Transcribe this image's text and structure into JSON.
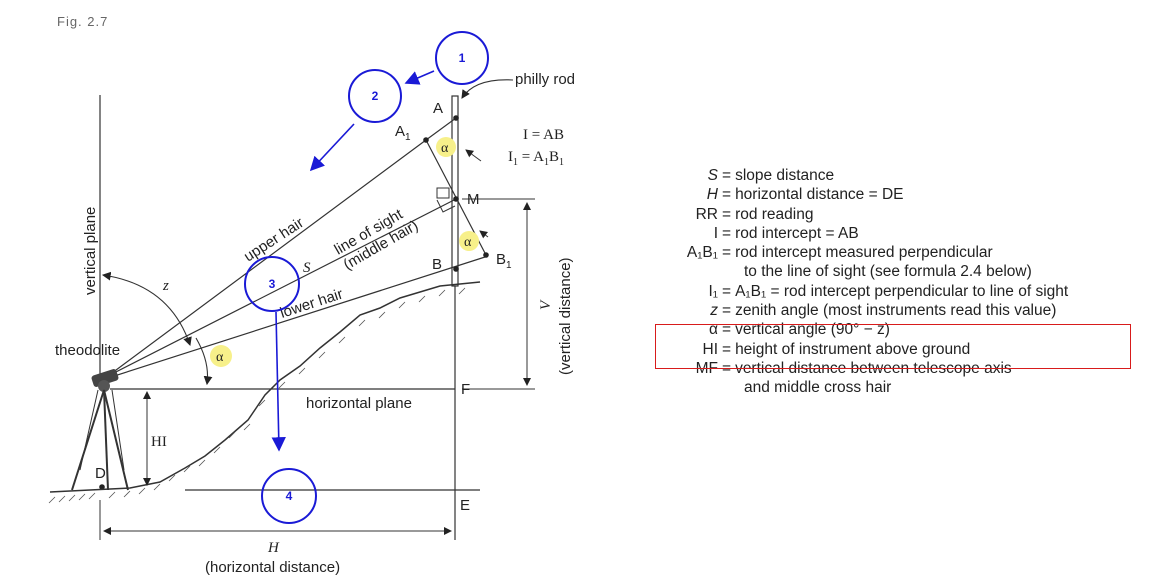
{
  "figure_header": "Fig. 2.7",
  "diagram": {
    "labels": {
      "philly_rod": "philly rod",
      "vertical_plane": "vertical plane",
      "upper_hair": "upper hair",
      "line_of_sight": "line of sight",
      "middle_hair": "(middle hair)",
      "lower_hair": "lower hair",
      "S": "S",
      "z": "z",
      "theodolite": "theodolite",
      "horizontal_plane": "horizontal plane",
      "HI": "HI",
      "D": "D",
      "A": "A",
      "A1": "A",
      "A1_sub": "1",
      "M": "M",
      "B": "B",
      "B1": "B",
      "B1_sub": "1",
      "F": "F",
      "E": "E",
      "V": "V",
      "vertical_distance": "(vertical distance)",
      "H": "H",
      "horizontal_distance": "(horizontal distance)",
      "I_eq": "I = AB",
      "I1_eq_a": "I",
      "I1_eq_sub": "1",
      "I1_eq_b": " = A",
      "I1_eq_c": "B",
      "alpha": "α"
    },
    "markers": [
      {
        "id": "1",
        "label": "1"
      },
      {
        "id": "2",
        "label": "2"
      },
      {
        "id": "3",
        "label": "3"
      },
      {
        "id": "4",
        "label": "4"
      }
    ],
    "colors": {
      "marker": "#1a1ad6",
      "highlight_dot": "#f7f08a",
      "highlight_box": "#d81b1b",
      "line": "#333333"
    }
  },
  "legend": {
    "rows": [
      {
        "term": "S",
        "italic": true,
        "def": "slope distance"
      },
      {
        "term": "H",
        "italic": true,
        "def": "horizontal distance = DE"
      },
      {
        "term": "RR",
        "italic": false,
        "def": "rod reading"
      },
      {
        "term": "I",
        "italic": false,
        "def": "rod intercept = AB"
      },
      {
        "term": "A₁B₁",
        "italic": false,
        "def": "rod intercept measured perpendicular"
      },
      {
        "cont": "to the line of sight (see formula 2.4 below)"
      },
      {
        "term": "I₁",
        "italic": false,
        "def": "A₁B₁ = rod intercept perpendicular to line of sight"
      },
      {
        "term": "z",
        "italic": true,
        "def": "zenith angle (most instruments read this value)"
      },
      {
        "term": "α",
        "italic": false,
        "def": "vertical angle (90° − z)"
      },
      {
        "term": "HI",
        "italic": false,
        "def": "height of instrument above ground"
      },
      {
        "term": "MF",
        "italic": false,
        "def": "vertical distance between telescope axis"
      },
      {
        "cont": "and middle cross hair"
      }
    ],
    "eq_sign": "="
  }
}
